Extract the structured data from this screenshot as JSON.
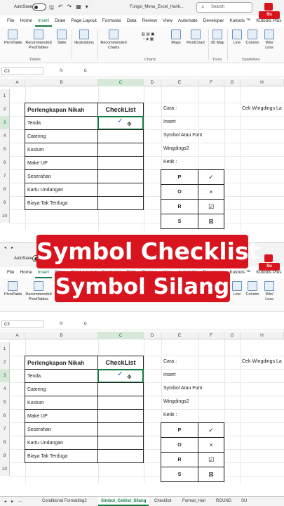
{
  "titlebar": {
    "autosave": "AutoSave",
    "toggle": "Off",
    "filename": "Fungsi_Menu_Excel_Harik...",
    "search": "Search"
  },
  "ribbon_tabs": [
    "File",
    "Home",
    "Insert",
    "Draw",
    "Page Layout",
    "Formulas",
    "Data",
    "Review",
    "View",
    "Automate",
    "Developer",
    "Kutools ™",
    "Kutools Plus"
  ],
  "ribbon_tabs_short": [
    "File",
    "Home",
    "Insert",
    "Draw",
    "Page Layout",
    "Formulas",
    "Data",
    "Review",
    "View",
    "Automate",
    "Developer",
    "Kutools ™",
    "Kutools Plus"
  ],
  "ribbon": {
    "pivottable": "PivotTable",
    "recommended_pivottables": "Recommended PivotTables",
    "table": "Table",
    "illustrations": "Illustrations",
    "recommended_charts": "Recommended Charts",
    "maps": "Maps",
    "pivotchart": "PivotChart",
    "map3d": "3D Map",
    "line": "Line",
    "column": "Column",
    "winloss": "Win/ Loss",
    "group_tables": "Tables",
    "group_charts": "Charts",
    "group_tours": "Tours",
    "group_sparklines": "Sparklines"
  },
  "formula": {
    "namebox": "C3",
    "fx": "fx",
    "value": "ü"
  },
  "columns": [
    "A",
    "B",
    "C",
    "D",
    "E",
    "F",
    "G",
    "H"
  ],
  "rows": [
    "1",
    "2",
    "3",
    "4",
    "5",
    "6",
    "7",
    "8",
    "9",
    "10"
  ],
  "table": {
    "header_item": "Perlengkapan Nikah",
    "header_check": "CheckList",
    "items": [
      "Tenda",
      "Catering",
      "Kostum",
      "Make UP",
      "Seserahan",
      "Kartu Undangan",
      "Biaya Tak Terduga"
    ],
    "check_symbol": "✓",
    "cursor": "✥"
  },
  "info": {
    "cara": "Cara :",
    "insert": "Insert",
    "symbol": "Symbol Atau Font",
    "font": "Wingdings2",
    "ketik": "Ketik :",
    "cek": "Cek Wingdings La"
  },
  "symbols": [
    {
      "key": "P",
      "glyph": "✓"
    },
    {
      "key": "O",
      "glyph": "×"
    },
    {
      "key": "R",
      "glyph": "☑"
    },
    {
      "key": "S",
      "glyph": "⊠"
    }
  ],
  "banner": {
    "line1": "Symbol Checklist",
    "line2": "Symbol Silang"
  },
  "sheets": [
    "Conditional Formatting2",
    "Simbol_Ceklist_Silang",
    "Checklist",
    "Format_Hari",
    "ROUND",
    "SU"
  ],
  "subscribe": "Su",
  "colors": {
    "accent": "#107c41",
    "banner": "#d8141e",
    "check": "#1a56c4"
  }
}
